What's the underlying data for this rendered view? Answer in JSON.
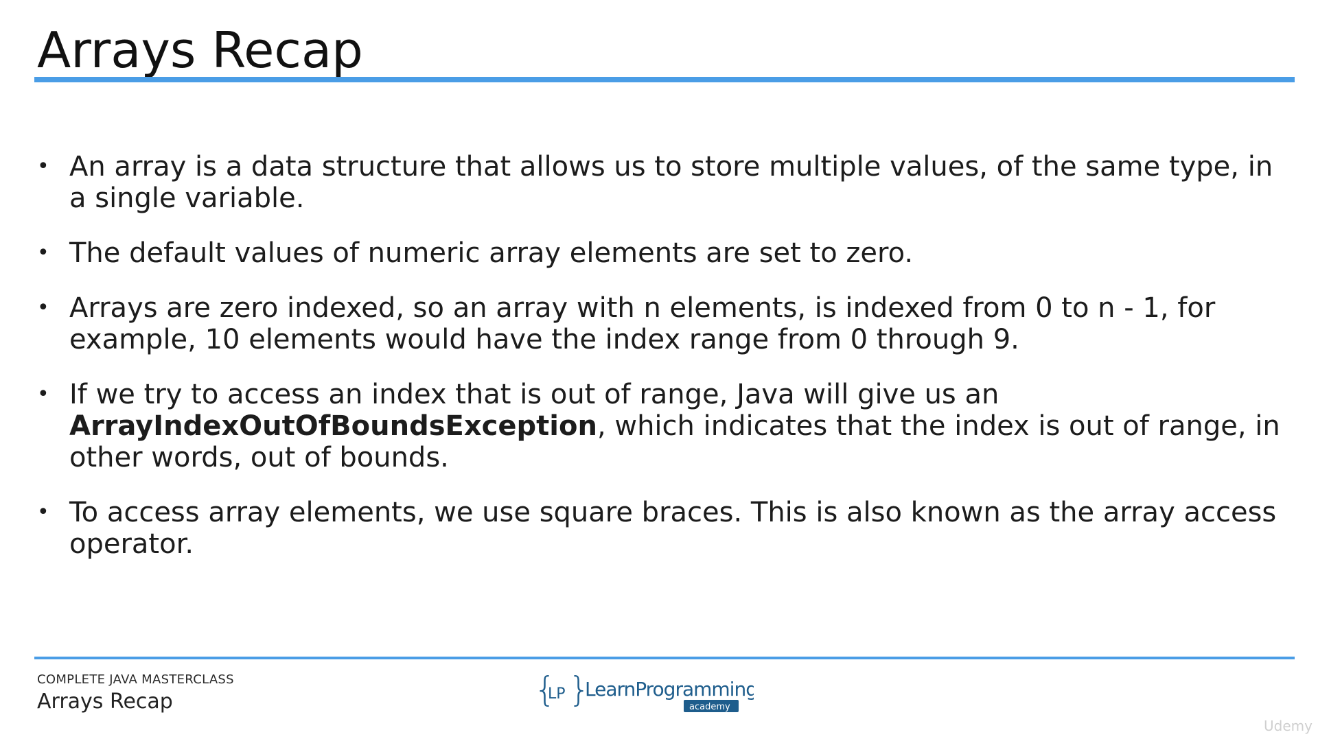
{
  "slide": {
    "title": "Arrays Recap"
  },
  "bullets": [
    {
      "text": "An array is a data structure that allows us to store multiple values, of the same type, in a single variable."
    },
    {
      "text": "The default values of numeric array elements are set to zero."
    },
    {
      "text": "Arrays are zero indexed, so an array with n elements, is indexed from 0 to n - 1, for example, 10 elements would have the index range from 0 through 9."
    },
    {
      "before": "If we try to access an index that is out of range, Java will give us an ",
      "bold": "ArrayIndexOutOfBoundsException",
      "after": ", which indicates that the index is out of range, in other words, out of bounds."
    },
    {
      "text": "To access array elements, we use square braces. This is also known as the array access operator."
    }
  ],
  "footer": {
    "course": "COMPLETE JAVA MASTERCLASS",
    "lecture": "Arrays Recap",
    "logo": {
      "braces_text": "LP",
      "brand_text": "LearnProgramming",
      "badge_text": "academy",
      "brand_color": "#1e5d8c",
      "badge_color": "#1e5d8c"
    },
    "watermark": "Udemy"
  },
  "colors": {
    "accent_rule": "#4a9de6",
    "text": "#1c1c1c"
  }
}
